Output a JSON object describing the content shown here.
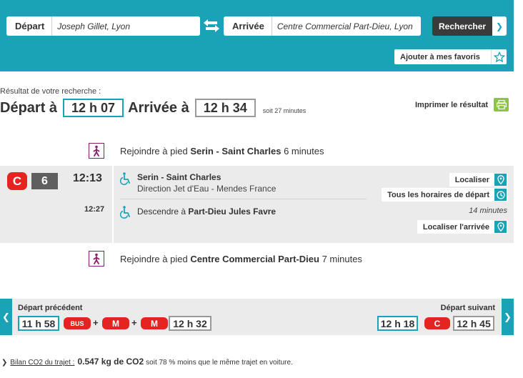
{
  "search": {
    "depart_label": "Départ",
    "depart_value": "Joseph Gillet, Lyon",
    "arrivee_label": "Arrivée",
    "arrivee_value": "Centre Commercial Part-Dieu, Lyon",
    "search_button": "Rechercher",
    "favorites_button": "Ajouter à mes favoris"
  },
  "result": {
    "caption": "Résultat de votre recherche :",
    "depart_label": "Départ à",
    "depart_time": "12 h 07",
    "arrivee_label": "Arrivée à",
    "arrivee_time": "12 h 34",
    "duration": "soit 27 minutes",
    "print_label": "Imprimer le résultat"
  },
  "walk_1": {
    "prefix": "Rejoindre à pied",
    "place": "Serin - Saint Charles",
    "duration": "6 minutes"
  },
  "segment": {
    "line_badge": "C",
    "line_number": "6",
    "departure_time": "12:13",
    "arrival_time": "12:27",
    "from_stop": "Serin - Saint Charles",
    "direction": "Direction Jet d'Eau - Mendes France",
    "to_prefix": "Descendre à",
    "to_stop": "Part-Dieu Jules Favre",
    "ride_duration": "14 minutes",
    "btn_localiser": "Localiser",
    "btn_horaires": "Tous les horaires de départ",
    "btn_localiser_arrivee": "Localiser l'arrivée"
  },
  "walk_2": {
    "prefix": "Rejoindre à pied",
    "place": "Centre Commercial Part-Dieu",
    "duration": "7 minutes"
  },
  "departures": {
    "prev_label": "Départ précédent",
    "prev_time": "11 h 58",
    "prev_modes": [
      "BUS",
      "M",
      "M"
    ],
    "plus": "+",
    "prev_arrival": "12 h 32",
    "next_label": "Départ suivant",
    "next_time": "12 h 18",
    "next_mode": "C",
    "next_arrival": "12 h 45"
  },
  "co2": {
    "link_label": "Bilan CO2 du trajet :",
    "value": "0.547 kg de CO2",
    "comparison": "soit 78 % moins que le même trajet en voiture."
  },
  "colors": {
    "accent": "#1aa3b6",
    "transit_red": "#e52421",
    "walk_purple": "#8b1c6b",
    "print_green": "#8cc63f",
    "segment_bg": "#ebebeb"
  }
}
